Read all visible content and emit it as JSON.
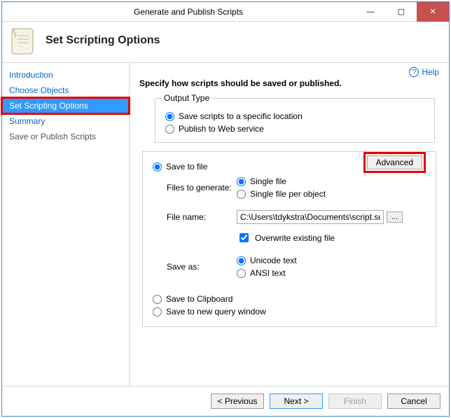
{
  "window": {
    "title": "Generate and Publish Scripts"
  },
  "header": {
    "title": "Set Scripting Options"
  },
  "help": {
    "label": "Help"
  },
  "sidebar": {
    "items": [
      {
        "label": "Introduction"
      },
      {
        "label": "Choose Objects"
      },
      {
        "label": "Set Scripting Options"
      },
      {
        "label": "Summary"
      },
      {
        "label": "Save or Publish Scripts"
      }
    ]
  },
  "content": {
    "heading": "Specify how scripts should be saved or published.",
    "output_type": {
      "legend": "Output Type",
      "save_location": "Save scripts to a specific location",
      "publish_web": "Publish to Web service"
    },
    "main": {
      "save_to_file": "Save to file",
      "advanced": "Advanced",
      "files_label": "Files to generate:",
      "single_file": "Single file",
      "single_per_object": "Single file per object",
      "file_name_label": "File name:",
      "file_name_value": "C:\\Users\\tdykstra\\Documents\\script.sql",
      "browse": "...",
      "overwrite": "Overwrite existing file",
      "save_as_label": "Save as:",
      "unicode": "Unicode text",
      "ansi": "ANSI text",
      "clipboard": "Save to Clipboard",
      "new_query": "Save to new query window"
    }
  },
  "footer": {
    "previous": "< Previous",
    "next": "Next >",
    "finish": "Finish",
    "cancel": "Cancel"
  }
}
